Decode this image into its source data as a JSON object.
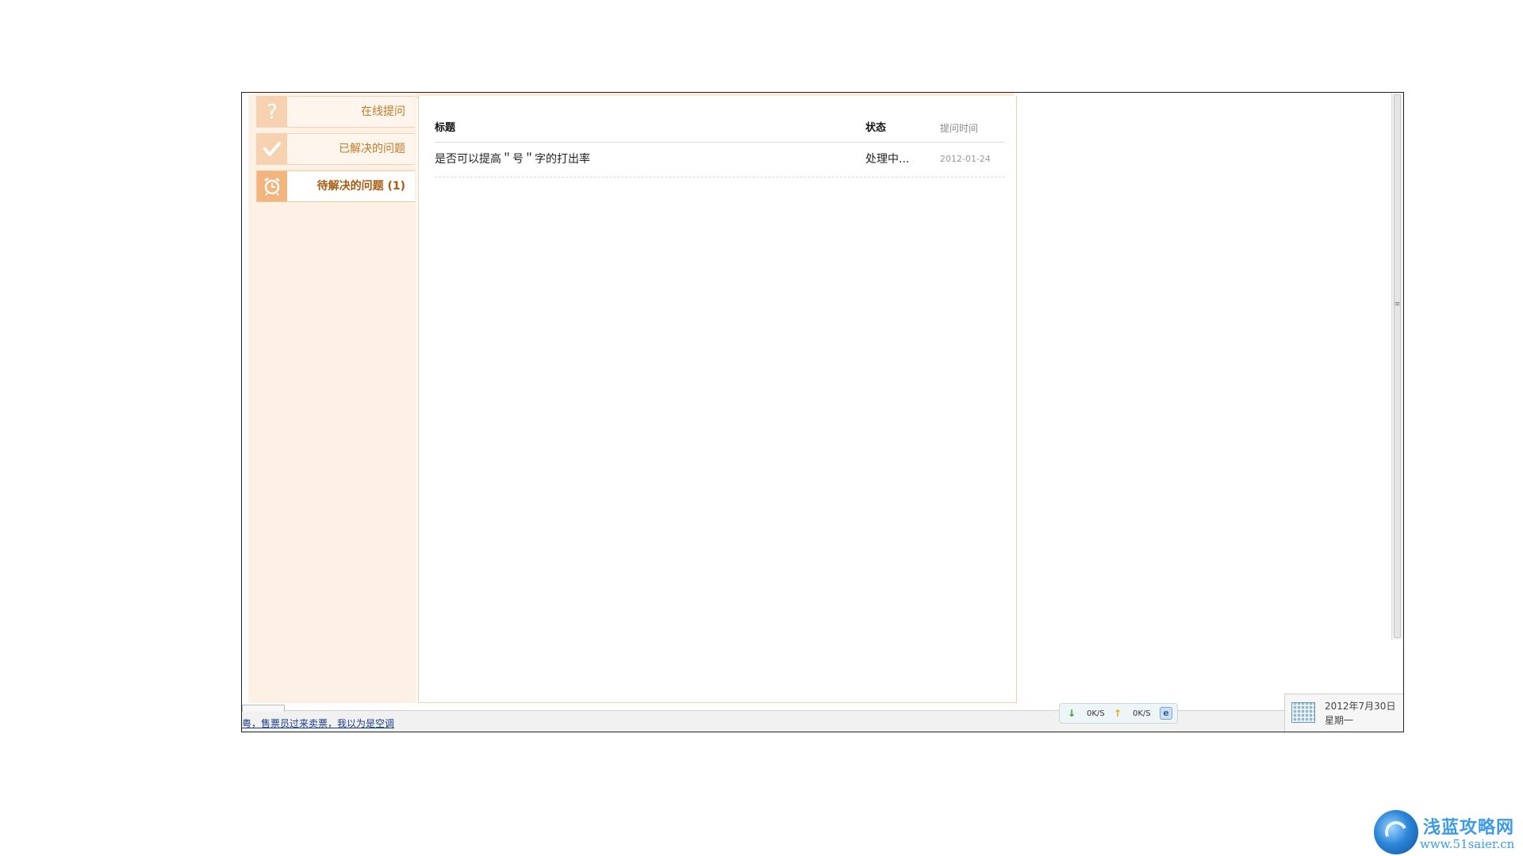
{
  "nav": {
    "items": [
      {
        "label": "在线提问",
        "icon": "question-icon"
      },
      {
        "label": "已解决的问题",
        "icon": "check-icon"
      },
      {
        "label": "待解决的问题 (1)",
        "icon": "alarm-clock-icon"
      }
    ],
    "active_index": 2
  },
  "table": {
    "headers": {
      "title": "标题",
      "status": "状态",
      "time": "提问时间"
    },
    "rows": [
      {
        "title": "是否可以提高＂号＂字的打出率",
        "status": "处理中...",
        "time": "2012-01-24"
      }
    ]
  },
  "statusbar": {
    "link_text": "粤，售票员过来卖票，我以为是空调",
    "net": {
      "down": "0K/S",
      "up": "0K/S"
    },
    "clock": {
      "date": "2012年7月30日",
      "day": "星期一"
    }
  },
  "watermark": {
    "title": "浅蓝攻略网",
    "url": "www.51saier.cn"
  },
  "colors": {
    "accent": "#c07a2a",
    "panel_bg": "#fdf1e6",
    "border": "#f1cfae"
  }
}
